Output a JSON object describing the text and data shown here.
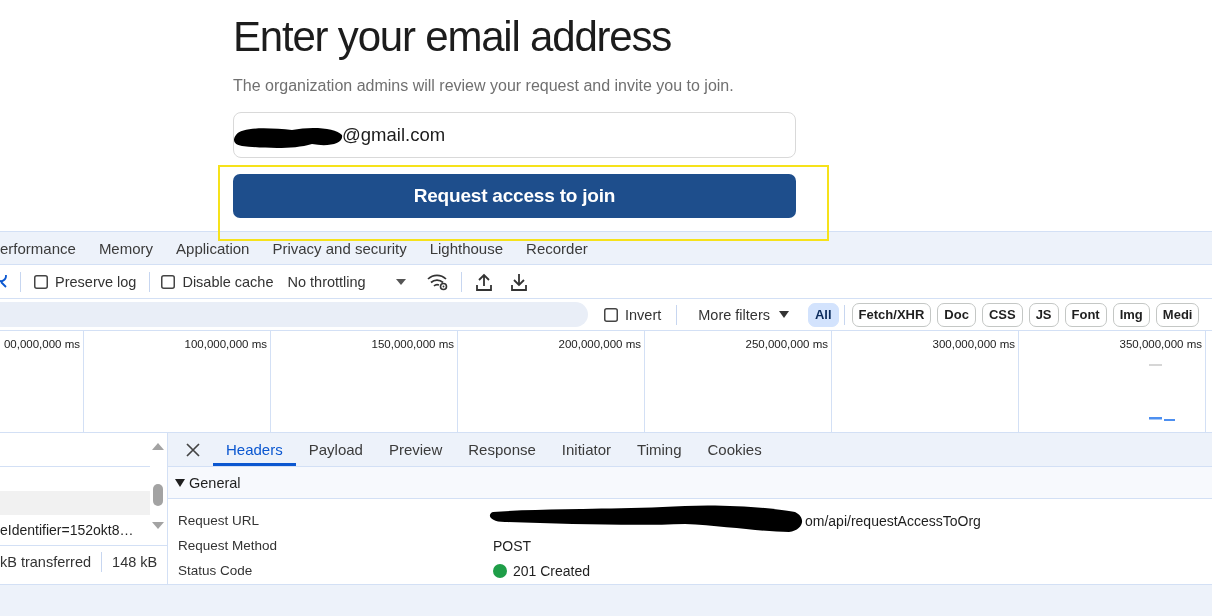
{
  "form": {
    "heading": "Enter your email address",
    "subtitle": "The organization admins will review your request and invite you to join.",
    "email": {
      "value": "@gmail.com",
      "redacted": true
    },
    "submit": "Request access to join",
    "highlighted": true
  },
  "devtools": {
    "panel_tabs": [
      {
        "label": "erformance",
        "selected": false
      },
      {
        "label": "Memory",
        "selected": false
      },
      {
        "label": "Application",
        "selected": false
      },
      {
        "label": "Privacy and security",
        "selected": false
      },
      {
        "label": "Lighthouse",
        "selected": false
      },
      {
        "label": "Recorder",
        "selected": false
      }
    ],
    "toolbar": {
      "preserve_log": {
        "label": "Preserve log",
        "checked": false
      },
      "disable_cache": {
        "label": "Disable cache",
        "checked": false
      },
      "throttling": "No throttling"
    },
    "filter_bar": {
      "invert": {
        "label": "Invert",
        "checked": false
      },
      "more_filters": "More filters",
      "types": [
        {
          "label": "All",
          "selected": true
        },
        {
          "label": "Fetch/XHR",
          "selected": false
        },
        {
          "label": "Doc",
          "selected": false
        },
        {
          "label": "CSS",
          "selected": false
        },
        {
          "label": "JS",
          "selected": false
        },
        {
          "label": "Font",
          "selected": false
        },
        {
          "label": "Img",
          "selected": false
        },
        {
          "label": "Medi",
          "selected": false
        }
      ]
    },
    "timeline": {
      "ticks": [
        "00,000,000 ms",
        "100,000,000 ms",
        "150,000,000 ms",
        "200,000,000 ms",
        "250,000,000 ms",
        "300,000,000 ms",
        "350,000,000 ms"
      ]
    },
    "request_list": {
      "visible_request": "eIdentifier=152okt8…",
      "transferred": "kB transferred",
      "resources": "148 kB"
    },
    "details": {
      "tabs": [
        {
          "label": "Headers",
          "selected": true
        },
        {
          "label": "Payload",
          "selected": false
        },
        {
          "label": "Preview",
          "selected": false
        },
        {
          "label": "Response",
          "selected": false
        },
        {
          "label": "Initiator",
          "selected": false
        },
        {
          "label": "Timing",
          "selected": false
        },
        {
          "label": "Cookies",
          "selected": false
        }
      ],
      "section": {
        "title": "General",
        "expanded": true
      },
      "fields": [
        {
          "label": "Request URL",
          "value": "om/api/requestAccessToOrg",
          "kind": "text",
          "redacted": true
        },
        {
          "label": "Request Method",
          "value": "POST",
          "kind": "text",
          "redacted": false
        },
        {
          "label": "Status Code",
          "value": "201 Created",
          "kind": "status",
          "redacted": false,
          "color": "#1e9e48"
        }
      ]
    }
  }
}
